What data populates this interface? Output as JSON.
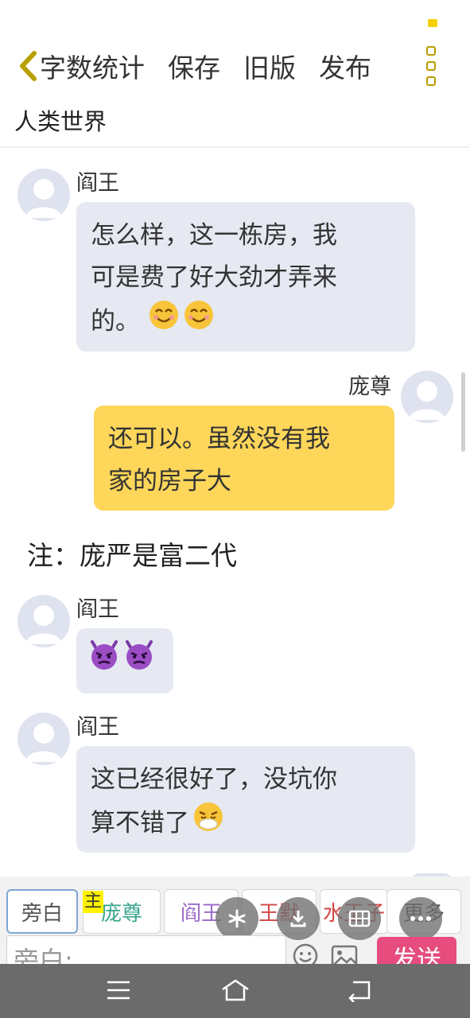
{
  "toolbar": {
    "word_count": "字数统计",
    "save": "保存",
    "old_version": "旧版",
    "publish": "发布"
  },
  "chat_title": "人类世界",
  "messages": [
    {
      "sender": "阎王",
      "side": "left",
      "lines": [
        "怎么样，这一栋房，我",
        "可是费了好大劲才弄来",
        "的。"
      ],
      "emoji": [
        "smiling-face-icon",
        "smiling-face-icon"
      ]
    },
    {
      "sender": "庞尊",
      "side": "right",
      "lines": [
        "还可以。虽然没有我",
        "家的房子大"
      ]
    },
    {
      "sender": "阎王",
      "side": "left",
      "emoji": [
        "angry-devil-icon",
        "angry-devil-icon"
      ]
    },
    {
      "sender": "阎王",
      "side": "left",
      "lines": [
        "这已经很好了，没坑你",
        "算不错了"
      ],
      "emoji": [
        "weary-face-icon"
      ]
    }
  ],
  "note": "注：庞严是富二代",
  "roles": {
    "badge": "主",
    "items": [
      {
        "label": "旁白",
        "color": "#555555"
      },
      {
        "label": "庞尊",
        "color": "#3aa58c"
      },
      {
        "label": "阎王",
        "color": "#9b6bc8"
      },
      {
        "label": "王默",
        "color": "#d24848"
      },
      {
        "label": "水王子",
        "color": "#d24848"
      },
      {
        "label": "更多",
        "color": "#555555"
      }
    ]
  },
  "input": {
    "placeholder": "旁白:"
  },
  "send_label": "发送",
  "colors": {
    "left_bubble": "#e6e9f2",
    "right_bubble": "#fdd65a",
    "send_button": "#e64c7d",
    "accent_dot": "#f4d000"
  }
}
